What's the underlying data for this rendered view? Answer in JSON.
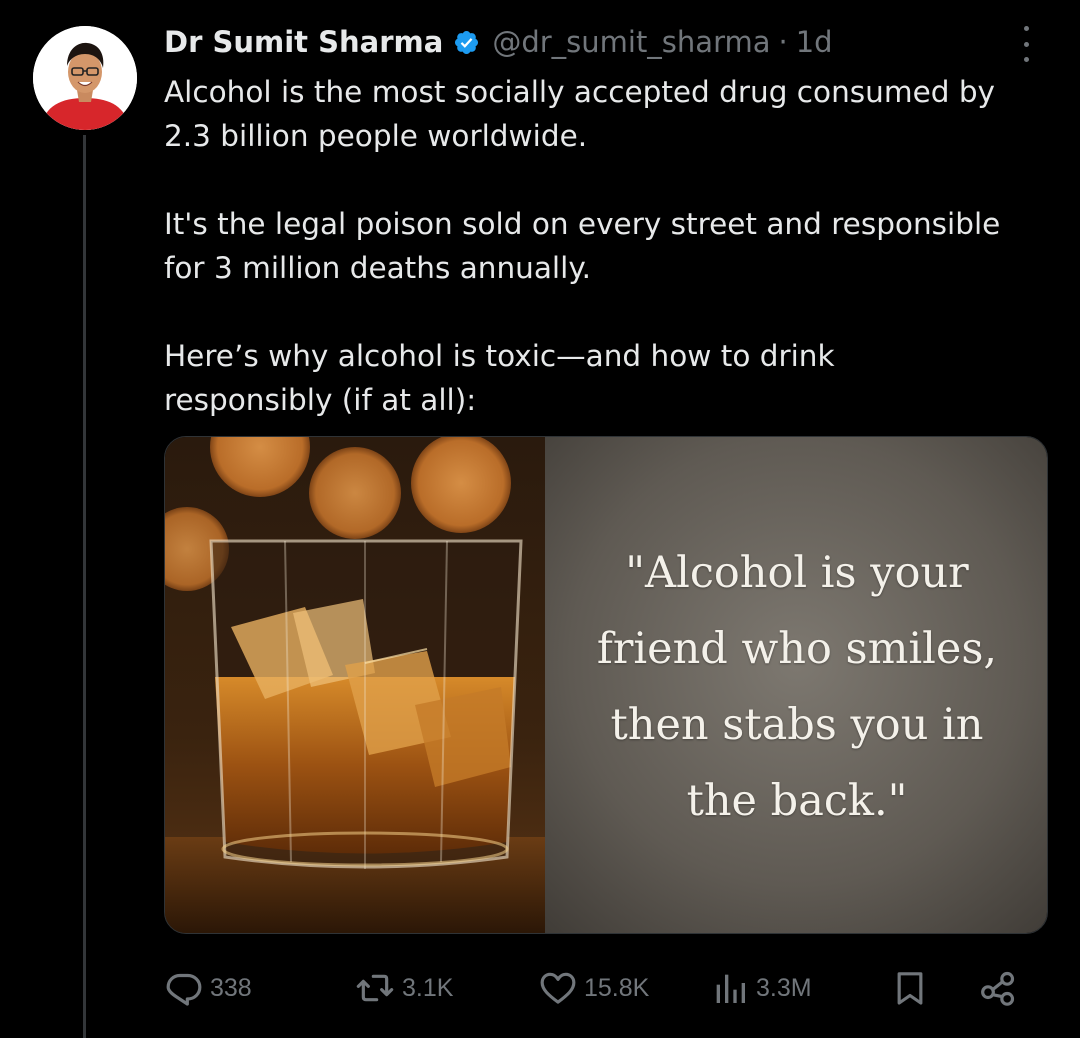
{
  "tweet": {
    "author": {
      "display_name": "Dr Sumit Sharma",
      "handle": "@dr_sumit_sharma",
      "time_separator": "·",
      "time": "1d",
      "verified": true
    },
    "paragraphs": [
      [
        "Alcohol is the most socially accepted drug consumed by",
        "2.3 billion people worldwide."
      ],
      [
        "It's the legal poison sold on every street and responsible",
        "for 3 million deaths annually."
      ],
      [
        "Here’s why alcohol is toxic—and how to drink",
        "responsibly (if at all):"
      ]
    ],
    "media": {
      "quote_lines": [
        "\"Alcohol is your",
        "friend who smiles,",
        "then stabs you in",
        "the back.\""
      ]
    },
    "actions": {
      "replies": "338",
      "reposts": "3.1K",
      "likes": "15.8K",
      "views": "3.3M"
    }
  },
  "colors": {
    "background": "#000000",
    "text_primary": "#e7e9ea",
    "text_secondary": "#71767b",
    "verified_blue": "#1d9bf0",
    "thread_line": "#333639"
  },
  "icons": [
    "more-icon",
    "verified-badge-icon",
    "reply-icon",
    "repost-icon",
    "like-icon",
    "views-icon",
    "bookmark-icon",
    "share-icon"
  ]
}
